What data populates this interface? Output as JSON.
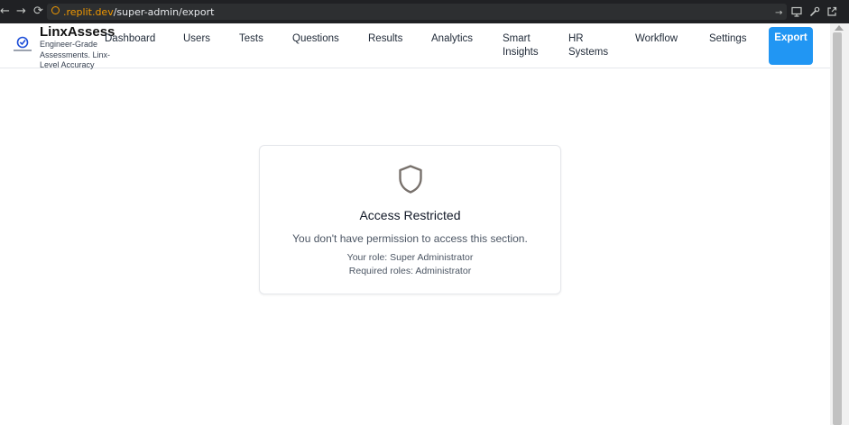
{
  "browser": {
    "url_host": ".replit.dev",
    "url_path": "/super-admin/export",
    "icons": [
      "back-arrow-icon",
      "forward-arrow-icon",
      "reload-icon",
      "site-info-icon",
      "go-arrow-icon",
      "screen-icon",
      "wrench-icon",
      "open-external-icon"
    ]
  },
  "brand": {
    "title": "LinxAssess",
    "subtitle": "Engineer-Grade Assessments. Linx-Level Accuracy"
  },
  "nav": {
    "items": [
      {
        "label": "Dashboard"
      },
      {
        "label": "Users"
      },
      {
        "label": "Tests"
      },
      {
        "label": "Questions"
      },
      {
        "label": "Results"
      },
      {
        "label": "Analytics"
      },
      {
        "label": "Smart Insights"
      },
      {
        "label": "HR Systems"
      },
      {
        "label": "Workflow"
      },
      {
        "label": "Settings"
      }
    ],
    "export_label": "Export"
  },
  "card": {
    "icon": "shield-icon",
    "title": "Access Restricted",
    "message": "You don't have permission to access this section.",
    "your_role": "Your role: Super Administrator",
    "required_roles": "Required roles: Administrator"
  },
  "colors": {
    "accent": "#2196f3",
    "icon_gray": "#78716c",
    "browser_bar": "#202124"
  }
}
